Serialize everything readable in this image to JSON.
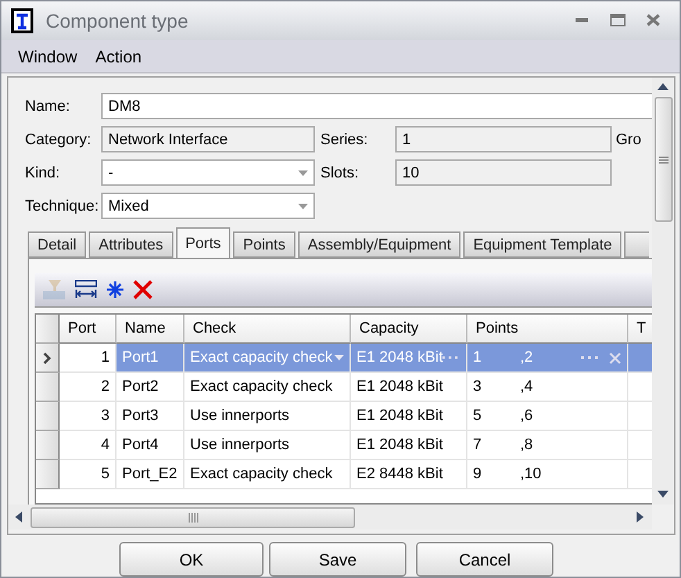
{
  "window": {
    "title": "Component type"
  },
  "menu": [
    "Window",
    "Action"
  ],
  "form": {
    "name_label": "Name:",
    "name": "DM8",
    "category_label": "Category:",
    "category": "Network Interface",
    "series_label": "Series:",
    "series": "1",
    "group_label": "Gro",
    "kind_label": "Kind:",
    "kind": "-",
    "slots_label": "Slots:",
    "slots": "10",
    "technique_label": "Technique:",
    "technique": "Mixed"
  },
  "tabs": [
    {
      "label": "Detail",
      "selected": false
    },
    {
      "label": "Attributes",
      "selected": false
    },
    {
      "label": "Ports",
      "selected": true
    },
    {
      "label": "Points",
      "selected": false
    },
    {
      "label": "Assembly/Equipment",
      "selected": false
    },
    {
      "label": "Equipment Template",
      "selected": false
    }
  ],
  "toolbar": [
    {
      "kind": "filter",
      "disabled": true
    },
    {
      "kind": "columns",
      "disabled": false
    },
    {
      "kind": "freeze",
      "disabled": false
    },
    {
      "kind": "delete",
      "disabled": false
    }
  ],
  "table": {
    "columns": [
      "Port",
      "Name",
      "Check",
      "Capacity",
      "Points",
      "T"
    ],
    "rows": [
      {
        "port": "1",
        "name": "Port1",
        "check": "Exact capacity check",
        "capacity": "E1 2048 kBit",
        "point_from": "1",
        "point_to": ",2",
        "selected": true
      },
      {
        "port": "2",
        "name": "Port2",
        "check": "Exact capacity check",
        "capacity": "E1 2048 kBit",
        "point_from": "3",
        "point_to": ",4",
        "selected": false
      },
      {
        "port": "3",
        "name": "Port3",
        "check": "Use innerports",
        "capacity": "E1 2048 kBit",
        "point_from": "5",
        "point_to": ",6",
        "selected": false
      },
      {
        "port": "4",
        "name": "Port4",
        "check": "Use innerports",
        "capacity": "E1 2048 kBit",
        "point_from": "7",
        "point_to": ",8",
        "selected": false
      },
      {
        "port": "5",
        "name": "Port_E2",
        "check": "Exact capacity check",
        "capacity": "E2 8448 kBit",
        "point_from": "9",
        "point_to": ",10",
        "selected": false
      }
    ]
  },
  "buttons": [
    "OK",
    "Save",
    "Cancel"
  ]
}
